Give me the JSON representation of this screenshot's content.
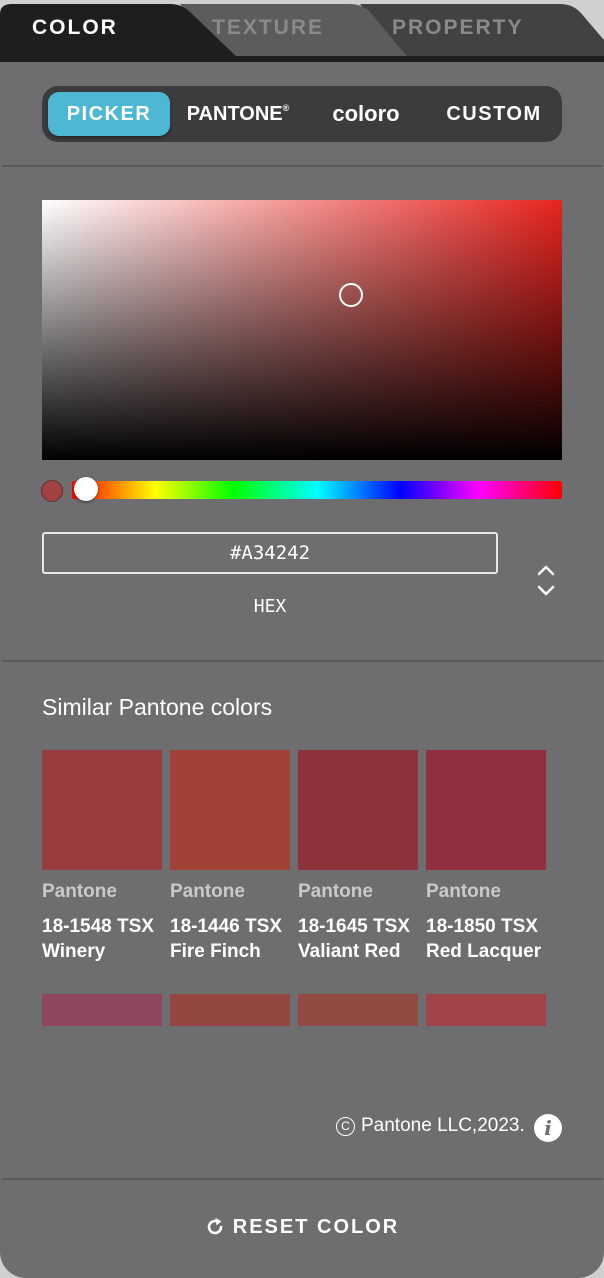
{
  "tabs": [
    {
      "label": "COLOR",
      "active": true
    },
    {
      "label": "TEXTURE",
      "active": false
    },
    {
      "label": "PROPERTY",
      "active": false
    }
  ],
  "subtabs": [
    {
      "label": "PICKER",
      "active": true
    },
    {
      "label": "PANTONE",
      "mark": "®"
    },
    {
      "label": "coloro"
    },
    {
      "label": "CUSTOM"
    }
  ],
  "picker": {
    "hex_value": "#A34242",
    "mode_label": "HEX",
    "hue_color": "#e8241f",
    "swatch_color": "#a34242"
  },
  "similar": {
    "title": "Similar Pantone colors",
    "colors": [
      {
        "brand": "Pantone",
        "code": "18-1548 TSX",
        "name": "Winery",
        "hex": "#983c3e"
      },
      {
        "brand": "Pantone",
        "code": "18-1446 TSX",
        "name": "Fire Finch",
        "hex": "#a24236"
      },
      {
        "brand": "Pantone",
        "code": "18-1645 TSX",
        "name": "Valiant Red",
        "hex": "#8e323d"
      },
      {
        "brand": "Pantone",
        "code": "18-1850 TSX",
        "name": "Red Lacquer",
        "hex": "#90303e"
      }
    ],
    "more_colors": [
      "#904660",
      "#944640",
      "#924a42",
      "#a0444a"
    ]
  },
  "footer": {
    "copyright": "Pantone LLC,2023.",
    "reset_label": "RESET COLOR"
  }
}
